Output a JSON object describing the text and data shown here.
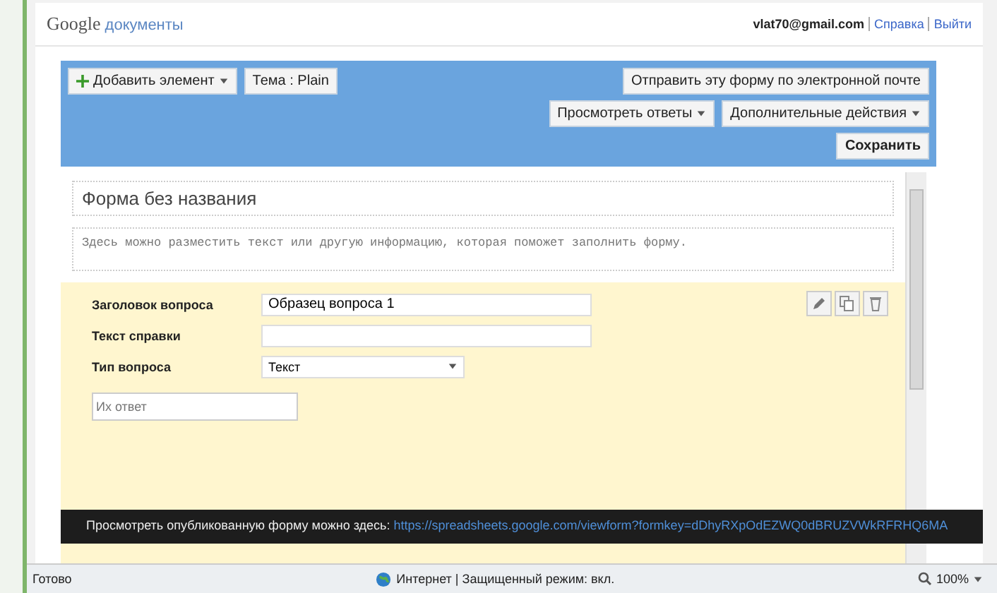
{
  "header": {
    "logo_brand": "Google",
    "logo_product": "документы",
    "user": "vlat70@gmail.com",
    "links": [
      "Справка",
      "Выйти"
    ]
  },
  "toolbar": {
    "add_button": "Добавить элемент",
    "theme_button": "Тема : Plain",
    "email_button": "Отправить эту форму по электронной почте",
    "responses_button": "Просмотреть ответы",
    "more_button": "Дополнительные действия",
    "save_button": "Сохранить"
  },
  "form": {
    "title": "Форма без названия",
    "description": "Здесь можно разместить текст или другую информацию, которая поможет заполнить форму."
  },
  "question": {
    "fields": [
      {
        "kind": "text",
        "label": "Заголовок вопроса",
        "value": "Образец вопроса 1"
      },
      {
        "kind": "text",
        "label": "Текст справки"
      },
      {
        "kind": "select",
        "label": "Тип вопроса",
        "value": "Текст"
      }
    ],
    "answer_placeholder": "Их ответ"
  },
  "notice": {
    "text": "Просмотреть опубликованную форму можно здесь:",
    "link": "https://spreadsheets.google.com/viewform?formkey=dDhyRXpOdEZWQ0dBRUZVWkRFRHQ6MA"
  },
  "status_bar": {
    "state": "Готово",
    "zone": "Интернет | Защищенный режим: вкл.",
    "zoom": "100%"
  }
}
